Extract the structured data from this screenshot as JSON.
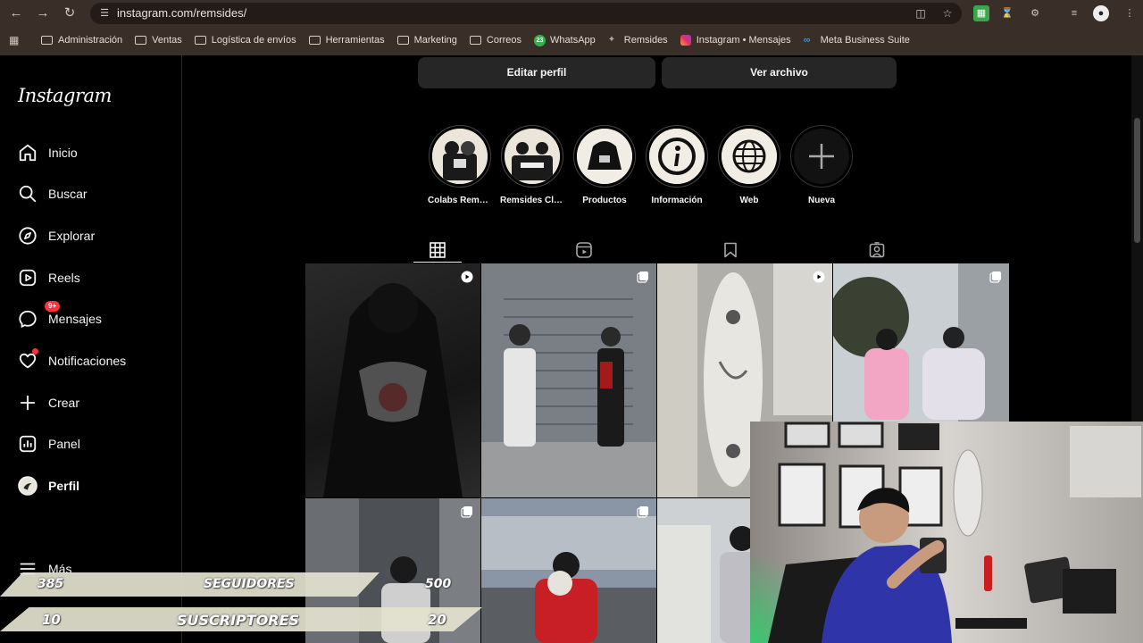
{
  "browser": {
    "url": "instagram.com/remsides/",
    "bookmarks": [
      {
        "label": "Administración",
        "type": "folder"
      },
      {
        "label": "Ventas",
        "type": "folder"
      },
      {
        "label": "Logística de envíos",
        "type": "folder"
      },
      {
        "label": "Herramientas",
        "type": "folder"
      },
      {
        "label": "Marketing",
        "type": "folder"
      },
      {
        "label": "Correos",
        "type": "folder"
      },
      {
        "label": "WhatsApp",
        "type": "whatsapp",
        "badge": "23"
      },
      {
        "label": "Remsides",
        "type": "site"
      },
      {
        "label": "Instagram • Mensajes",
        "type": "instagram"
      },
      {
        "label": "Meta Business Suite",
        "type": "meta"
      }
    ]
  },
  "sidebar": {
    "logo": "Instagram",
    "items": [
      {
        "label": "Inicio",
        "icon": "home-icon"
      },
      {
        "label": "Buscar",
        "icon": "search-icon"
      },
      {
        "label": "Explorar",
        "icon": "compass-icon"
      },
      {
        "label": "Reels",
        "icon": "reels-icon"
      },
      {
        "label": "Mensajes",
        "icon": "messenger-icon",
        "badge": "9+"
      },
      {
        "label": "Notificaciones",
        "icon": "heart-icon"
      },
      {
        "label": "Crear",
        "icon": "plus-icon"
      },
      {
        "label": "Panel",
        "icon": "dashboard-icon"
      },
      {
        "label": "Perfil",
        "icon": "avatar-icon"
      },
      {
        "label": "Más",
        "icon": "menu-icon"
      }
    ]
  },
  "profile": {
    "edit_button": "Editar perfil",
    "archive_button": "Ver archivo",
    "highlights": [
      {
        "label": "Colabs Remsi..."
      },
      {
        "label": "Remsides Club"
      },
      {
        "label": "Productos"
      },
      {
        "label": "Información"
      },
      {
        "label": "Web"
      },
      {
        "label": "Nueva"
      }
    ],
    "tabs": [
      "posts-grid-icon",
      "reels-icon",
      "saved-icon",
      "tagged-icon"
    ]
  },
  "overlay": {
    "followers": {
      "current": "385",
      "label": "SEGUIDORES",
      "goal": "500"
    },
    "subscribers": {
      "current": "10",
      "label": "SUSCRIPTORES",
      "goal": "20"
    }
  },
  "colors": {
    "browser_bg": "#3a2f28",
    "instagram_bg": "#000000",
    "notification_red": "#ff3040",
    "overlay_band": "#e4e2cf"
  }
}
